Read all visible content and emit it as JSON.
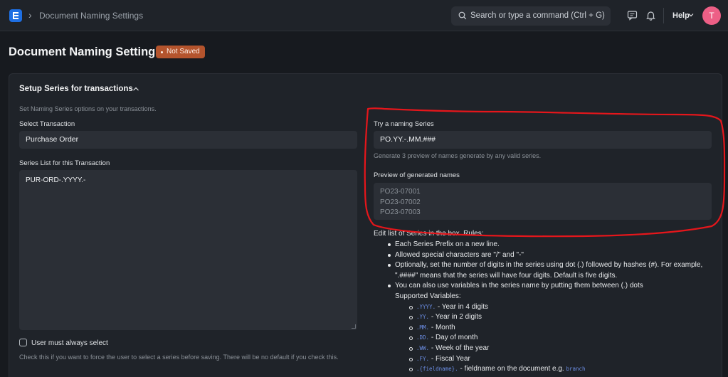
{
  "navbar": {
    "breadcrumb": "Document Naming Settings",
    "search_placeholder": "Search or type a command (Ctrl + G)",
    "help_label": "Help",
    "avatar_initial": "T"
  },
  "page": {
    "title": "Document Naming Settings",
    "status_badge": "Not Saved"
  },
  "section": {
    "title": "Setup Series for transactions",
    "description": "Set Naming Series options on your transactions."
  },
  "left": {
    "select_transaction_label": "Select Transaction",
    "select_transaction_value": "Purchase Order",
    "series_list_label": "Series List for this Transaction",
    "series_list_value": "PUR-ORD-.YYYY.-",
    "checkbox_label": "User must always select",
    "checkbox_description": "Check this if you want to force the user to select a series before saving. There will be no default if you check this."
  },
  "right": {
    "try_label": "Try a naming Series",
    "try_value": "PO.YY.-.MM.###",
    "try_description": "Generate 3 preview of names generate by any valid series.",
    "preview_label": "Preview of generated names",
    "preview_names": [
      "PO23-07001",
      "PO23-07002",
      "PO23-07003"
    ]
  },
  "rules": {
    "heading": "Edit list of Series in the box. Rules:",
    "items": [
      "Each Series Prefix on a new line.",
      "Allowed special characters are \"/\" and \"-\"",
      "Optionally, set the number of digits in the series using dot (.) followed by hashes (#). For example, \".####\" means that the series will have four digits. Default is five digits.",
      "You can also use variables in the series name by putting them between (.) dots"
    ],
    "supported_label": "Supported Variables:",
    "variables": [
      {
        "code": ".YYYY.",
        "text": "- Year in 4 digits"
      },
      {
        "code": ".YY.",
        "text": "- Year in 2 digits"
      },
      {
        "code": ".MM.",
        "text": "- Month"
      },
      {
        "code": ".DD.",
        "text": "- Day of month"
      },
      {
        "code": ".WW.",
        "text": "- Week of the year"
      },
      {
        "code": ".FY.",
        "text": "- Fiscal Year"
      },
      {
        "code": ".{fieldname}.",
        "text": "- fieldname on the document e.g.",
        "extra": "branch"
      }
    ]
  },
  "colors": {
    "accent": "#1e6fe3",
    "badge": "#b4542d",
    "annotation": "#e5161b",
    "avatar": "#ed5f86"
  }
}
